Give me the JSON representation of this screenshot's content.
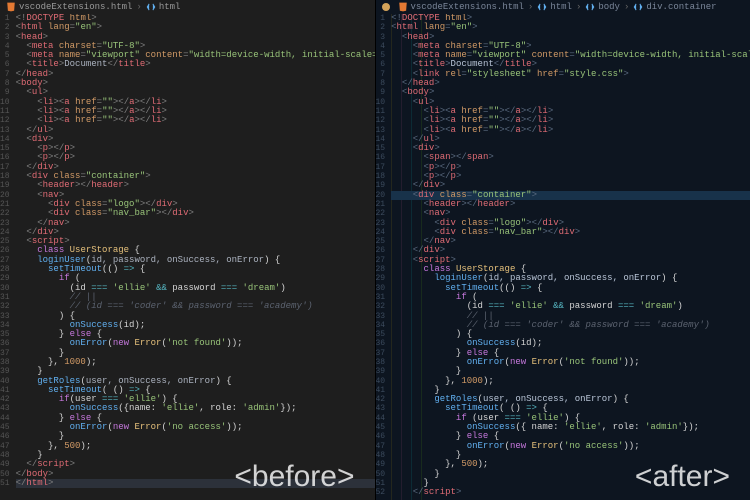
{
  "left": {
    "crumbs": [
      "vscodeExtensions.html",
      "html"
    ],
    "file_icon_color": "#e37933",
    "overlay": "<before>",
    "lines": [
      {
        "n": 1,
        "i": 0,
        "t": "doctype",
        "txt": "<!DOCTYPE html>"
      },
      {
        "n": 2,
        "i": 0,
        "t": "tag",
        "tag": "html",
        "attrs": [
          [
            "lang",
            "en"
          ]
        ],
        "open": true
      },
      {
        "n": 3,
        "i": 0,
        "t": "tag",
        "tag": "head",
        "open": true
      },
      {
        "n": 4,
        "i": 1,
        "t": "selfclose",
        "tag": "meta",
        "attrs": [
          [
            "charset",
            "UTF-8"
          ]
        ]
      },
      {
        "n": 5,
        "i": 1,
        "t": "selfclose",
        "tag": "meta",
        "attrs": [
          [
            "name",
            "viewport"
          ],
          [
            "content",
            "width=device-width, initial-scale=1.0"
          ]
        ]
      },
      {
        "n": 6,
        "i": 1,
        "t": "wrap",
        "tag": "title",
        "inner": "Document"
      },
      {
        "n": 7,
        "i": 0,
        "t": "close",
        "tag": "head"
      },
      {
        "n": 8,
        "i": 0,
        "t": "tag",
        "tag": "body",
        "open": true
      },
      {
        "n": 9,
        "i": 1,
        "t": "tag",
        "tag": "ul",
        "open": true
      },
      {
        "n": 10,
        "i": 2,
        "t": "li_a"
      },
      {
        "n": 11,
        "i": 2,
        "t": "li_a"
      },
      {
        "n": 12,
        "i": 2,
        "t": "li_a"
      },
      {
        "n": 13,
        "i": 1,
        "t": "close",
        "tag": "ul"
      },
      {
        "n": 14,
        "i": 1,
        "t": "tag",
        "tag": "div",
        "open": true
      },
      {
        "n": 15,
        "i": 2,
        "t": "empty",
        "tag": "p"
      },
      {
        "n": 16,
        "i": 2,
        "t": "empty",
        "tag": "p"
      },
      {
        "n": 17,
        "i": 1,
        "t": "close",
        "tag": "div"
      },
      {
        "n": 18,
        "i": 1,
        "t": "tag",
        "tag": "div",
        "attrs": [
          [
            "class",
            "container"
          ]
        ],
        "open": true
      },
      {
        "n": 19,
        "i": 2,
        "t": "empty",
        "tag": "header"
      },
      {
        "n": 20,
        "i": 2,
        "t": "tag",
        "tag": "nav",
        "open": true
      },
      {
        "n": 21,
        "i": 3,
        "t": "empty",
        "tag": "div",
        "attrs": [
          [
            "class",
            "logo"
          ]
        ]
      },
      {
        "n": 22,
        "i": 3,
        "t": "empty",
        "tag": "div",
        "attrs": [
          [
            "class",
            "nav_bar"
          ]
        ]
      },
      {
        "n": 23,
        "i": 2,
        "t": "close",
        "tag": "nav"
      },
      {
        "n": 24,
        "i": 1,
        "t": "close",
        "tag": "div"
      },
      {
        "n": 25,
        "i": 1,
        "t": "tag",
        "tag": "script",
        "open": true
      },
      {
        "n": 26,
        "i": 2,
        "t": "js",
        "raw": "<kw>class</kw> <cls>UserStorage</cls> {"
      },
      {
        "n": 27,
        "i": 2,
        "t": "js",
        "raw": "<fn>loginUser</fn>(<txt>id, password, onSuccess, onError</txt>) {"
      },
      {
        "n": 28,
        "i": 3,
        "t": "js",
        "raw": "<fn>setTimeout</fn>(() <op>=></op> {"
      },
      {
        "n": 29,
        "i": 4,
        "t": "js",
        "raw": "<kw>if</kw> ("
      },
      {
        "n": 30,
        "i": 5,
        "t": "js",
        "raw": "(id <op>===</op> <str>'ellie'</str> <op>&&</op> password <op>===</op> <str>'dream'</str>)"
      },
      {
        "n": 31,
        "i": 5,
        "t": "js",
        "raw": "<com>// ||</com>"
      },
      {
        "n": 32,
        "i": 5,
        "t": "js",
        "raw": "<com>// (id === 'coder' && password === 'academy')</com>"
      },
      {
        "n": 33,
        "i": 4,
        "t": "js",
        "raw": ") {"
      },
      {
        "n": 34,
        "i": 5,
        "t": "js",
        "raw": "<fn>onSuccess</fn>(id);"
      },
      {
        "n": 35,
        "i": 4,
        "t": "js",
        "raw": "} <kw>else</kw> {"
      },
      {
        "n": 36,
        "i": 5,
        "t": "js",
        "raw": "<fn>onError</fn>(<kw>new</kw> <cls>Error</cls>(<str>'not found'</str>));"
      },
      {
        "n": 37,
        "i": 4,
        "t": "js",
        "raw": "}"
      },
      {
        "n": 38,
        "i": 3,
        "t": "js",
        "raw": "}, <num>1000</num>);"
      },
      {
        "n": 39,
        "i": 2,
        "t": "js",
        "raw": "}"
      },
      {
        "n": 40,
        "i": 2,
        "t": "js",
        "raw": "<fn>getRoles</fn>(<txt>user, onSuccess, onError</txt>) {"
      },
      {
        "n": 41,
        "i": 3,
        "t": "js",
        "raw": "<fn>setTimeout</fn>( () <op>=></op> {"
      },
      {
        "n": 42,
        "i": 4,
        "t": "js",
        "raw": "<kw>if</kw>(user <op>===</op> <str>'ellie'</str>) {"
      },
      {
        "n": 43,
        "i": 5,
        "t": "js",
        "raw": "<fn>onSuccess</fn>({name: <str>'ellie'</str>, role: <str>'admin'</str>});"
      },
      {
        "n": 44,
        "i": 4,
        "t": "js",
        "raw": "} <kw>else</kw> {"
      },
      {
        "n": 45,
        "i": 5,
        "t": "js",
        "raw": "<fn>onError</fn>(<kw>new</kw> <cls>Error</cls>(<str>'no access'</str>));"
      },
      {
        "n": 46,
        "i": 4,
        "t": "js",
        "raw": "}"
      },
      {
        "n": 47,
        "i": 3,
        "t": "js",
        "raw": "}, <num>500</num>);"
      },
      {
        "n": 48,
        "i": 2,
        "t": "js",
        "raw": "}"
      },
      {
        "n": 49,
        "i": 1,
        "t": "close",
        "tag": "script"
      },
      {
        "n": 50,
        "i": 0,
        "t": "close",
        "tag": "body"
      },
      {
        "n": 51,
        "i": 0,
        "t": "close",
        "tag": "html",
        "hl": true
      }
    ]
  },
  "right": {
    "crumbs": [
      "vscodeExtensions.html",
      "html",
      "body",
      "div.container"
    ],
    "file_icon_color": "#e37933",
    "overlay": "<after>",
    "lines": [
      {
        "n": 1,
        "i": 0,
        "t": "doctype",
        "txt": "<!DOCTYPE html>"
      },
      {
        "n": 2,
        "i": 0,
        "t": "tag",
        "tag": "html",
        "attrs": [
          [
            "lang",
            "en"
          ]
        ],
        "open": true
      },
      {
        "n": 3,
        "i": 1,
        "t": "tag",
        "tag": "head",
        "open": true
      },
      {
        "n": 4,
        "i": 2,
        "t": "selfclose",
        "tag": "meta",
        "attrs": [
          [
            "charset",
            "UTF-8"
          ]
        ]
      },
      {
        "n": 5,
        "i": 2,
        "t": "selfclose",
        "tag": "meta",
        "attrs": [
          [
            "name",
            "viewport"
          ],
          [
            "content",
            "width=device-width, initial-scale=1.0"
          ]
        ]
      },
      {
        "n": 6,
        "i": 2,
        "t": "wrap",
        "tag": "title",
        "inner": "Document"
      },
      {
        "n": 7,
        "i": 2,
        "t": "selfclose",
        "tag": "link",
        "attrs": [
          [
            "rel",
            "stylesheet"
          ],
          [
            "href",
            "style.css"
          ]
        ]
      },
      {
        "n": 8,
        "i": 1,
        "t": "close",
        "tag": "head"
      },
      {
        "n": 9,
        "i": 1,
        "t": "tag",
        "tag": "body",
        "open": true
      },
      {
        "n": 10,
        "i": 2,
        "t": "tag",
        "tag": "ul",
        "open": true
      },
      {
        "n": 11,
        "i": 3,
        "t": "li_a"
      },
      {
        "n": 12,
        "i": 3,
        "t": "li_a"
      },
      {
        "n": 13,
        "i": 3,
        "t": "li_a"
      },
      {
        "n": 14,
        "i": 2,
        "t": "close",
        "tag": "ul"
      },
      {
        "n": 15,
        "i": 2,
        "t": "tag",
        "tag": "div",
        "open": true
      },
      {
        "n": 16,
        "i": 3,
        "t": "empty",
        "tag": "span"
      },
      {
        "n": 17,
        "i": 3,
        "t": "empty",
        "tag": "p"
      },
      {
        "n": 18,
        "i": 3,
        "t": "empty",
        "tag": "p"
      },
      {
        "n": 19,
        "i": 2,
        "t": "close",
        "tag": "div"
      },
      {
        "n": 20,
        "i": 2,
        "t": "tag",
        "tag": "div",
        "attrs": [
          [
            "class",
            "container"
          ]
        ],
        "open": true,
        "hl": true
      },
      {
        "n": 21,
        "i": 3,
        "t": "empty",
        "tag": "header"
      },
      {
        "n": 22,
        "i": 3,
        "t": "tag",
        "tag": "nav",
        "open": true
      },
      {
        "n": 23,
        "i": 4,
        "t": "empty",
        "tag": "div",
        "attrs": [
          [
            "class",
            "logo"
          ]
        ]
      },
      {
        "n": 24,
        "i": 4,
        "t": "empty",
        "tag": "div",
        "attrs": [
          [
            "class",
            "nav_bar"
          ]
        ]
      },
      {
        "n": 25,
        "i": 3,
        "t": "close",
        "tag": "nav"
      },
      {
        "n": 26,
        "i": 2,
        "t": "close",
        "tag": "div"
      },
      {
        "n": 27,
        "i": 2,
        "t": "tag",
        "tag": "script",
        "open": true
      },
      {
        "n": 28,
        "i": 3,
        "t": "js",
        "raw": "<kw>class</kw> <cls>UserStorage</cls> {"
      },
      {
        "n": 29,
        "i": 4,
        "t": "js",
        "raw": "<fn>loginUser</fn>(<txt>id, password, onSuccess, onError</txt>) {"
      },
      {
        "n": 30,
        "i": 5,
        "t": "js",
        "raw": "<fn>setTimeout</fn>(() <op>=></op> {"
      },
      {
        "n": 31,
        "i": 6,
        "t": "js",
        "raw": "<kw>if</kw> ("
      },
      {
        "n": 32,
        "i": 7,
        "t": "js",
        "raw": "(id <op>===</op> <str>'ellie'</str> <op>&&</op> password <op>===</op> <str>'dream'</str>)"
      },
      {
        "n": 33,
        "i": 7,
        "t": "js",
        "raw": "<com>// ||</com>"
      },
      {
        "n": 34,
        "i": 7,
        "t": "js",
        "raw": "<com>// (id === 'coder' && password === 'academy')</com>"
      },
      {
        "n": 35,
        "i": 6,
        "t": "js",
        "raw": ") {"
      },
      {
        "n": 36,
        "i": 7,
        "t": "js",
        "raw": "<fn>onSuccess</fn>(id);"
      },
      {
        "n": 37,
        "i": 6,
        "t": "js",
        "raw": "} <kw>else</kw> {"
      },
      {
        "n": 38,
        "i": 7,
        "t": "js",
        "raw": "<fn>onError</fn>(<kw>new</kw> <cls>Error</cls>(<str>'not found'</str>));"
      },
      {
        "n": 39,
        "i": 6,
        "t": "js",
        "raw": "}"
      },
      {
        "n": 40,
        "i": 5,
        "t": "js",
        "raw": "}, <num>1000</num>);"
      },
      {
        "n": 41,
        "i": 4,
        "t": "js",
        "raw": "}"
      },
      {
        "n": 42,
        "i": 4,
        "t": "js",
        "raw": "<fn>getRoles</fn>(<txt>user, onSuccess, onError</txt>) {"
      },
      {
        "n": 43,
        "i": 5,
        "t": "js",
        "raw": "<fn>setTimeout</fn>( () <op>=></op> {"
      },
      {
        "n": 44,
        "i": 6,
        "t": "js",
        "raw": "<kw>if</kw> (user <op>===</op> <str>'ellie'</str>) {"
      },
      {
        "n": 45,
        "i": 7,
        "t": "js",
        "raw": "<fn>onSuccess</fn>({ name: <str>'ellie'</str>, role: <str>'admin'</str>});"
      },
      {
        "n": 46,
        "i": 6,
        "t": "js",
        "raw": "} <kw>else</kw> {"
      },
      {
        "n": 47,
        "i": 7,
        "t": "js",
        "raw": "<fn>onError</fn>(<kw>new</kw> <cls>Error</cls>(<str>'no access'</str>));"
      },
      {
        "n": 48,
        "i": 6,
        "t": "js",
        "raw": "}"
      },
      {
        "n": 49,
        "i": 5,
        "t": "js",
        "raw": "}, <num>500</num>);"
      },
      {
        "n": 50,
        "i": 4,
        "t": "js",
        "raw": "}"
      },
      {
        "n": 51,
        "i": 3,
        "t": "js",
        "raw": "}"
      },
      {
        "n": 52,
        "i": 2,
        "t": "close",
        "tag": "script"
      }
    ]
  }
}
